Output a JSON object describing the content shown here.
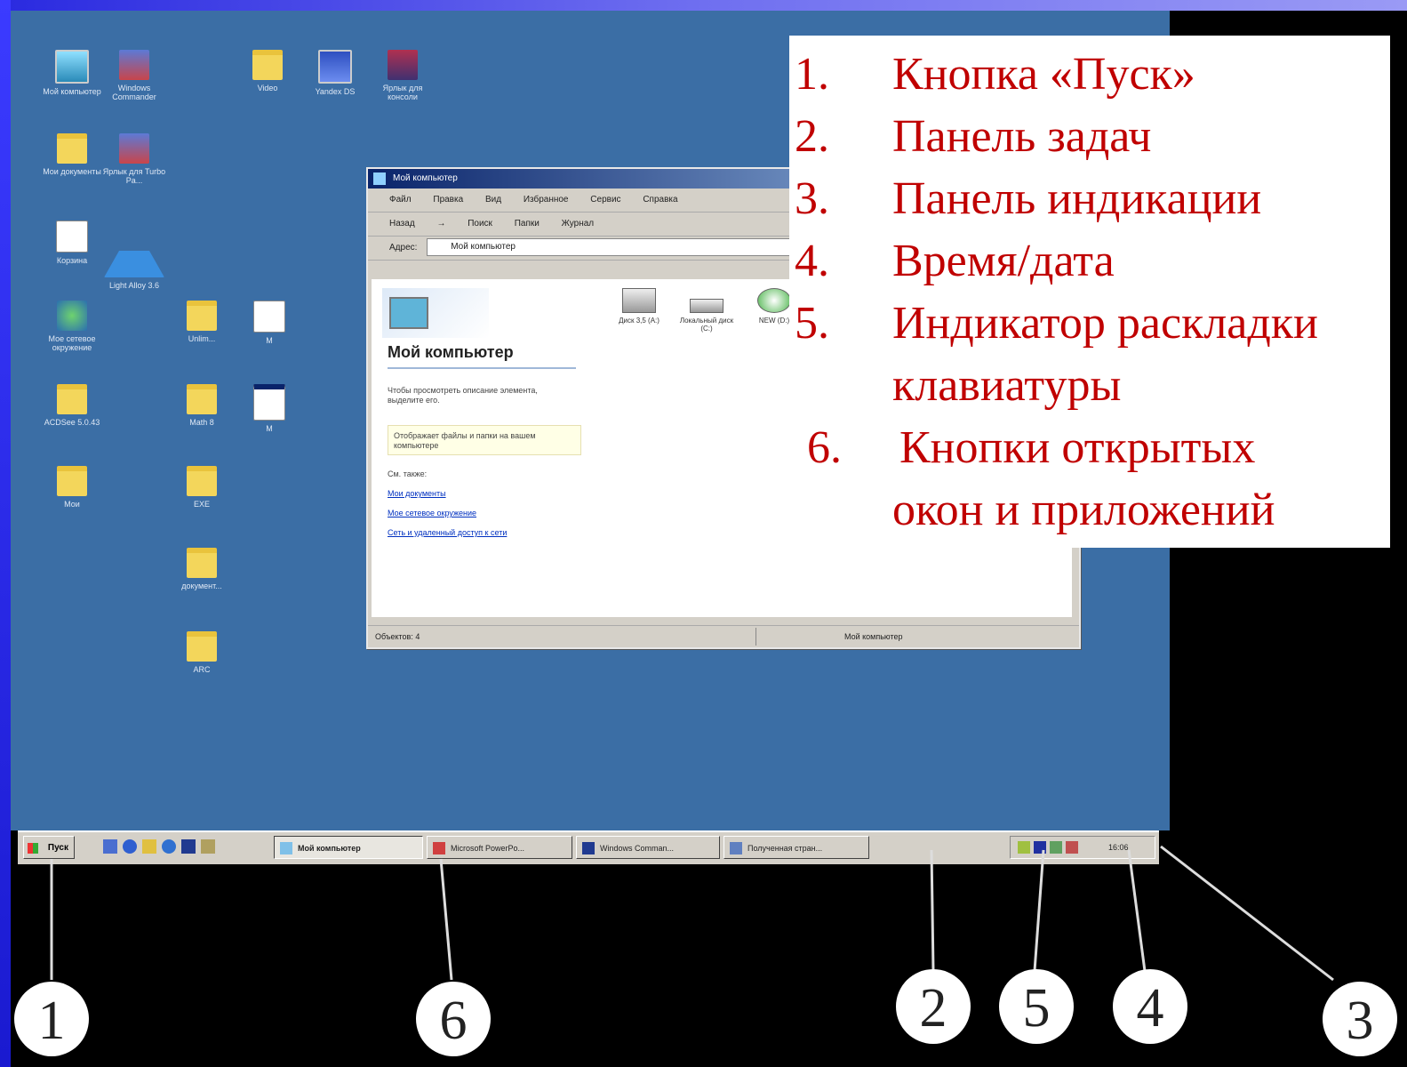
{
  "desktop": {
    "icons": [
      {
        "label": "Мой компьютер",
        "icon": "computer-icon"
      },
      {
        "label": "Windows Commander",
        "icon": "app-icon"
      },
      {
        "label": "Video",
        "icon": "folder-icon"
      },
      {
        "label": "Yandex DS",
        "icon": "app-icon"
      },
      {
        "label": "Ярлык для консоли",
        "icon": "app-icon"
      },
      {
        "label": "Мои документы",
        "icon": "folder-icon"
      },
      {
        "label": "Ярлык для Turbo Pa...",
        "icon": "app-icon"
      },
      {
        "label": "Корзина",
        "icon": "recycle-bin-icon"
      },
      {
        "label": "Light Alloy 3.6",
        "icon": "app-icon"
      },
      {
        "label": "Мое сетевое окружение",
        "icon": "network-icon"
      },
      {
        "label": "ACDSee 5.0.43",
        "icon": "folder-icon"
      },
      {
        "label": "Мои",
        "icon": "folder-icon"
      },
      {
        "label": "Unlim...",
        "icon": "folder-icon"
      },
      {
        "label": "Math 8",
        "icon": "folder-icon"
      },
      {
        "label": "EXE",
        "icon": "folder-icon"
      },
      {
        "label": "документ...",
        "icon": "folder-icon"
      },
      {
        "label": "ARC",
        "icon": "folder-icon"
      },
      {
        "label": "M",
        "icon": "document-icon"
      },
      {
        "label": "M",
        "icon": "window-icon"
      }
    ]
  },
  "window": {
    "title": "Мой компьютер",
    "menu": [
      "Файл",
      "Правка",
      "Вид",
      "Избранное",
      "Сервис",
      "Справка"
    ],
    "toolbar": [
      "Назад",
      "→",
      "Поиск",
      "Папки",
      "Журнал"
    ],
    "address_label": "Адрес:",
    "address_value": "Мой компьютер",
    "taskpane": {
      "title": "Мой компьютер",
      "hint": "Чтобы просмотреть описание элемента, выделите его.",
      "highlight": "Отображает файлы и папки на вашем компьютере",
      "see_also": "См. также:",
      "links": [
        "Мои документы",
        "Мое сетевое окружение",
        "Сеть и удаленный доступ к сети"
      ]
    },
    "drives": [
      {
        "label": "Диск 3,5 (A:)",
        "icon": "floppy-drive-icon"
      },
      {
        "label": "Локальный диск (C:)",
        "icon": "hard-drive-icon"
      },
      {
        "label": "NEW (D:)",
        "icon": "cd-drive-icon"
      }
    ],
    "status_left": "Объектов: 4",
    "status_right": "Мой компьютер"
  },
  "taskbar": {
    "start_label": "Пуск",
    "buttons": [
      "Мой компьютер",
      "Microsoft PowerPo...",
      "Windows Comman...",
      "Полученная стран..."
    ],
    "clock": "16:06"
  },
  "legend": [
    {
      "num": "1.",
      "text": "Кнопка «Пуск»"
    },
    {
      "num": "2.",
      "text": "Панель задач"
    },
    {
      "num": "3.",
      "text": "Панель индикации"
    },
    {
      "num": "4.",
      "text": "Время/дата"
    },
    {
      "num": "5.",
      "text": "Индикатор раскладки"
    },
    {
      "num": "",
      "text": "клавиатуры"
    },
    {
      "num": "6.",
      "text": "Кнопки открытых"
    },
    {
      "num": "",
      "text": "окон и приложений"
    }
  ],
  "callouts": [
    "1",
    "6",
    "2",
    "5",
    "4",
    "3"
  ],
  "colors": {
    "desktop": "#3b6ea5",
    "taskbar": "#d4d0c8",
    "legend_text": "#c00000",
    "frame_accent": "#3b3bff"
  }
}
